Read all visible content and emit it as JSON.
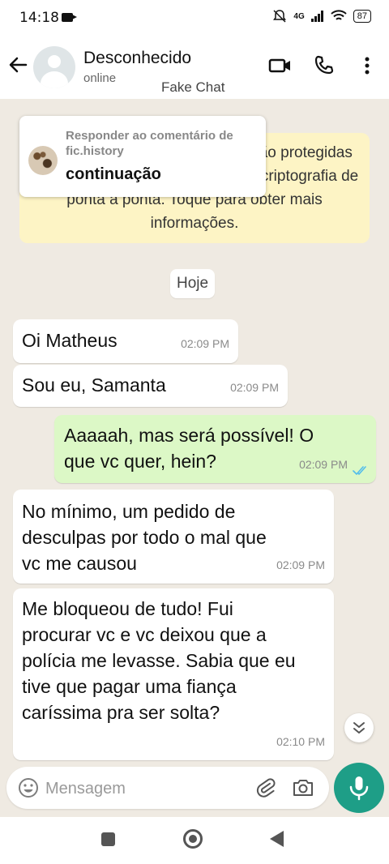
{
  "status_bar": {
    "time": "14:18",
    "network": "4G",
    "battery": "87"
  },
  "header": {
    "contact_name": "Desconhecido",
    "contact_status": "online",
    "watermark": "Fake Chat"
  },
  "encryption_notice": "As mensagens e as chamadas são protegidas desta conversa são seguras com criptografia de ponta a ponta. Toque para obter mais informações.",
  "overlay": {
    "label": "Responder ao comentário de fic.history",
    "title": "continuação"
  },
  "date_separator": "Hoje",
  "messages": [
    {
      "direction": "incoming",
      "text": "Oi Matheus",
      "time": "02:09 PM"
    },
    {
      "direction": "incoming",
      "text": "Sou eu, Samanta",
      "time": "02:09 PM"
    },
    {
      "direction": "outgoing",
      "text": "Aaaaah, mas será possível! O que vc quer, hein?",
      "time": "02:09 PM",
      "status": "read"
    },
    {
      "direction": "incoming",
      "text": "No mínimo, um pedido de desculpas por todo o mal que vc me causou",
      "time": "02:09 PM"
    },
    {
      "direction": "incoming",
      "text": "Me bloqueou de tudo! Fui procurar vc e vc deixou que a polícia me levasse. Sabia que eu tive que pagar uma fiança caríssima pra ser solta?",
      "time": "02:10 PM"
    }
  ],
  "input": {
    "placeholder": "Mensagem",
    "value": ""
  },
  "colors": {
    "chat_background": "#efeae2",
    "outgoing_bubble": "#dcf8c6",
    "incoming_bubble": "#ffffff",
    "mic_button": "#1e9e87",
    "read_ticks": "#53bdeb",
    "encryption_notice": "#fdf4c5"
  },
  "icons": [
    "back-arrow-icon",
    "video-call-icon",
    "phone-icon",
    "more-options-icon",
    "double-check-icon",
    "scroll-down-icon",
    "emoji-icon",
    "attach-icon",
    "camera-icon",
    "microphone-icon"
  ]
}
